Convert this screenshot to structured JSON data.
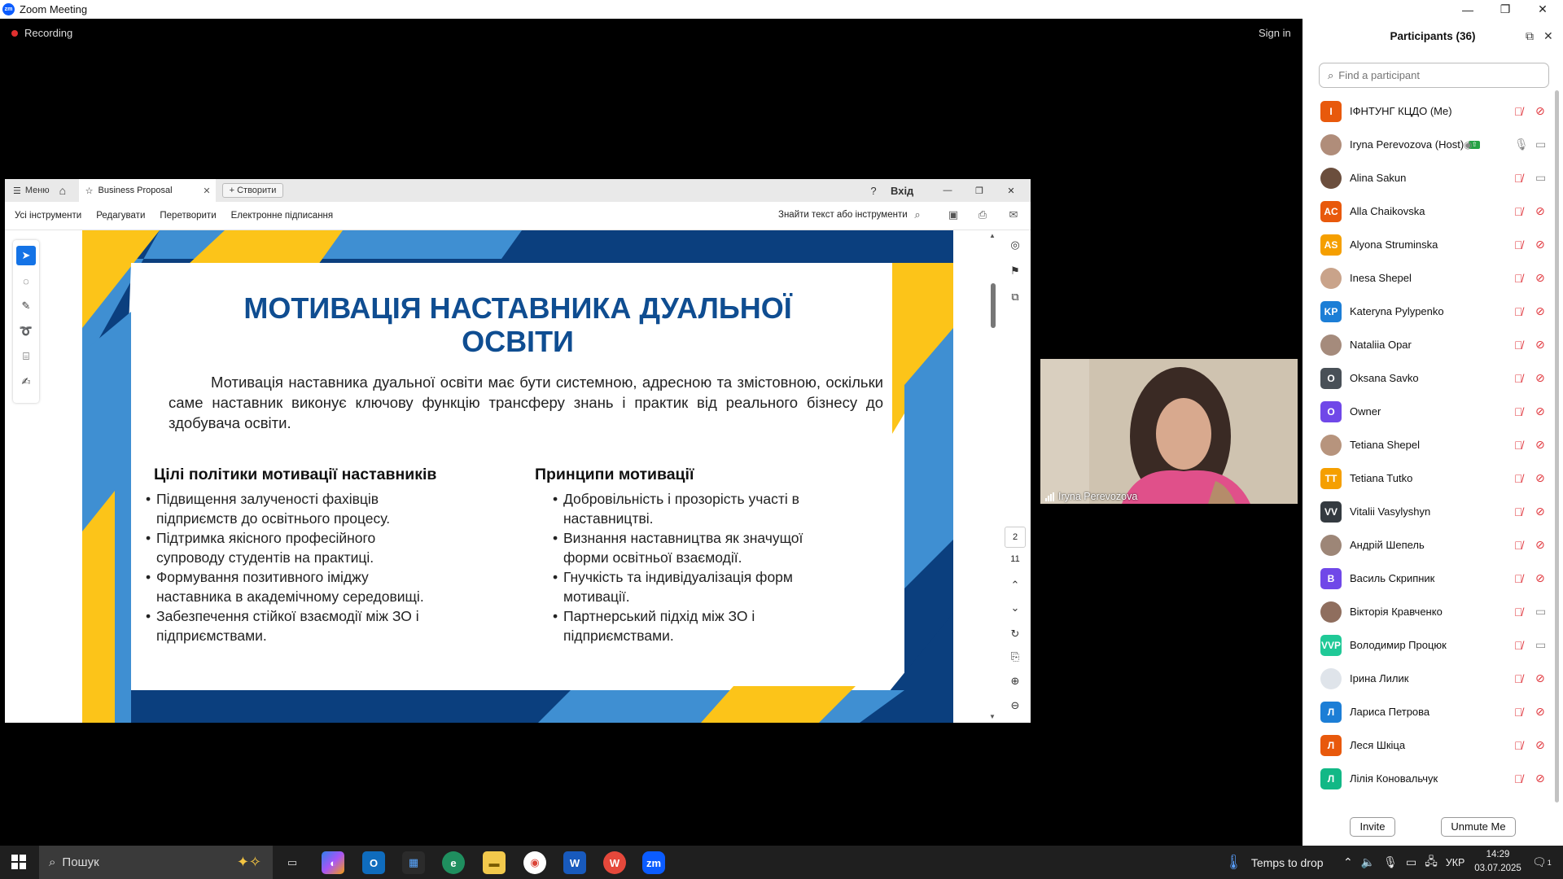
{
  "window": {
    "title": "Zoom Meeting",
    "minimize": "—",
    "restore": "❐",
    "close": "✕"
  },
  "meeting": {
    "recording_label": "Recording",
    "sign_in": "Sign in"
  },
  "acrobat": {
    "menu_label": "Меню",
    "tab_title": "Business Proposal",
    "create_label": "+ Створити",
    "signin_label": "Вхід",
    "toolbar": {
      "all_tools": "Усі інструменти",
      "edit": "Редагувати",
      "convert": "Перетворити",
      "esign": "Електронне підписання",
      "find": "Знайти текст або інструменти"
    },
    "page": {
      "current": "2",
      "total": "11"
    }
  },
  "slide": {
    "title_line1": "МОТИВАЦІЯ НАСТАВНИКА ДУАЛЬНОЇ",
    "title_line2": "ОСВІТИ",
    "intro": "Мотивація наставника дуальної освіти має бути системною, адресною та змістовною, оскільки саме наставник виконує ключову функцію трансферу знань і практик від реального бізнесу до здобувача освіти.",
    "left_heading": "Цілі політики мотивації наставників",
    "left_items": [
      "Підвищення залученості фахівців підприємств до освітнього процесу.",
      "Підтримка якісного професійного супроводу студентів на практиці.",
      "Формування позитивного іміджу наставника в академічному середовищі.",
      "Забезпечення стійкої взаємодії між ЗО і підприємствами."
    ],
    "right_heading": "Принципи мотивації",
    "right_items": [
      "Добровільність і прозорість участі в наставництві.",
      "Визнання наставництва як значущої форми освітньої взаємодії.",
      "Гнучкість та індивідуалізація форм мотивації.",
      "Партнерський підхід між ЗО і підприємствами."
    ],
    "colors": {
      "navy": "#0b3f7e",
      "blue": "#3f8fd2",
      "yellow": "#fcc419",
      "title": "#0f4d91"
    }
  },
  "video": {
    "name": "Iryna Perevozova"
  },
  "participants": {
    "header": "Participants (36)",
    "search_placeholder": "Find a participant",
    "invite": "Invite",
    "unmute_me": "Unmute Me",
    "list": [
      {
        "name": "ІФНТУНГ КЦДО (Me)",
        "initials": "І",
        "color": "#e8590c",
        "mic": "muted",
        "cam": "off"
      },
      {
        "name": "Iryna Perevozova (Host)",
        "initials": "",
        "color": "#b08d7a",
        "mic": "on",
        "cam": "on",
        "host": true
      },
      {
        "name": "Alina Sakun",
        "initials": "",
        "color": "#6b4e3d",
        "mic": "muted",
        "cam": "on"
      },
      {
        "name": "Alla Chaikovska",
        "initials": "AC",
        "color": "#e8590c",
        "mic": "muted",
        "cam": "off"
      },
      {
        "name": "Alyona Struminska",
        "initials": "AS",
        "color": "#f59f00",
        "mic": "muted",
        "cam": "off"
      },
      {
        "name": "Inesa Shepel",
        "initials": "",
        "color": "#c9a38a",
        "mic": "muted",
        "cam": "off"
      },
      {
        "name": "Kateryna Pylypenko",
        "initials": "KP",
        "color": "#1c7ed6",
        "mic": "muted",
        "cam": "off"
      },
      {
        "name": "Nataliia Opar",
        "initials": "",
        "color": "#a58b7c",
        "mic": "muted",
        "cam": "off"
      },
      {
        "name": "Oksana Savko",
        "initials": "O",
        "color": "#495057",
        "mic": "muted",
        "cam": "off"
      },
      {
        "name": "Owner",
        "initials": "O",
        "color": "#7048e8",
        "mic": "muted",
        "cam": "off"
      },
      {
        "name": "Tetiana Shepel",
        "initials": "",
        "color": "#b7947d",
        "mic": "muted",
        "cam": "off"
      },
      {
        "name": "Tetiana Tutko",
        "initials": "TT",
        "color": "#f59f00",
        "mic": "muted",
        "cam": "off"
      },
      {
        "name": "Vitalii Vasylyshyn",
        "initials": "VV",
        "color": "#343a40",
        "mic": "muted",
        "cam": "off"
      },
      {
        "name": "Андрій Шепель",
        "initials": "",
        "color": "#9d8677",
        "mic": "muted",
        "cam": "off"
      },
      {
        "name": "Василь Скрипник",
        "initials": "В",
        "color": "#7048e8",
        "mic": "muted",
        "cam": "off"
      },
      {
        "name": "Вікторія Кравченко",
        "initials": "",
        "color": "#8f6e5e",
        "mic": "muted",
        "cam": "on"
      },
      {
        "name": "Володимир Процюк",
        "initials": "VVP",
        "color": "#20c997",
        "mic": "muted",
        "cam": "on"
      },
      {
        "name": "Ірина Лилик",
        "initials": "",
        "color": "#dfe4ea",
        "mic": "muted",
        "cam": "off"
      },
      {
        "name": "Лариса Петрова",
        "initials": "Л",
        "color": "#1c7ed6",
        "mic": "muted",
        "cam": "off"
      },
      {
        "name": "Леся Шкіца",
        "initials": "Л",
        "color": "#e8590c",
        "mic": "muted",
        "cam": "off"
      },
      {
        "name": "Лілія Коновальчук",
        "initials": "Л",
        "color": "#12b886",
        "mic": "muted",
        "cam": "off"
      }
    ]
  },
  "taskbar": {
    "search_label": "Пошук",
    "weather": "Temps to drop",
    "language": "УКР",
    "time": "14:29",
    "date": "03.07.2025",
    "notifications": "1"
  }
}
